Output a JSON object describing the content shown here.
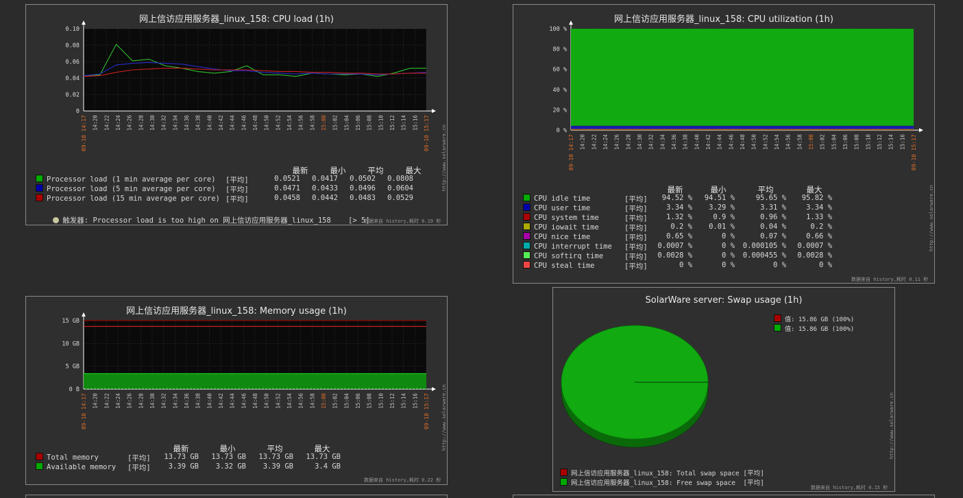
{
  "common": {
    "hdr": [
      "最新",
      "最小",
      "平均",
      "最大"
    ],
    "avg_tag": "[平均]",
    "xticks": [
      "14:20",
      "14:22",
      "14:24",
      "14:26",
      "14:28",
      "14:30",
      "14:32",
      "14:34",
      "14:36",
      "14:38",
      "14:40",
      "14:42",
      "14:44",
      "14:46",
      "14:48",
      "14:50",
      "14:52",
      "14:54",
      "14:56",
      "14:58",
      "15:00",
      "15:02",
      "15:04",
      "15:06",
      "15:08",
      "15:10",
      "15:12",
      "15:14",
      "15:16"
    ],
    "x_start": "09-10 14:17",
    "x_end": "09-10 15:17",
    "watermark": "http://www.solarware.cn",
    "colors": {
      "green": "#00c800",
      "blue": "#0000c8",
      "red": "#c80000",
      "orange": "#e0702a",
      "bg": "#2b2b2b",
      "plot": "#0a0a0a"
    }
  },
  "cpu_load": {
    "title": "网上信访应用服务器_linux_158: CPU load (1h)",
    "footer": "数据来自 history,耗时 0.19 秒",
    "legend": [
      {
        "color": "#00aa00",
        "name": "Processor load (1 min average per core)",
        "vals": [
          "0.0521",
          "0.0417",
          "0.0502",
          "0.0808"
        ]
      },
      {
        "color": "#0000aa",
        "name": "Processor load (5 min average per core)",
        "vals": [
          "0.0471",
          "0.0433",
          "0.0496",
          "0.0604"
        ]
      },
      {
        "color": "#aa0000",
        "name": "Processor load (15 min average per core)",
        "vals": [
          "0.0458",
          "0.0442",
          "0.0483",
          "0.0529"
        ]
      }
    ],
    "trigger_label": "触发器",
    "trigger_text": ": Processor load is too high on 网上信访应用服务器_linux_158    [> 5]"
  },
  "cpu_util": {
    "title": "网上信访应用服务器_linux_158: CPU utilization (1h)",
    "footer": "数据来自 history,耗时 0.11 秒",
    "legend": [
      {
        "color": "#00aa00",
        "name": "CPU idle time",
        "vals": [
          "94.52 %",
          "94.51 %",
          "95.65 %",
          "95.82 %"
        ]
      },
      {
        "color": "#0000aa",
        "name": "CPU user time",
        "vals": [
          "3.34 %",
          "3.29 %",
          "3.31 %",
          "3.34 %"
        ]
      },
      {
        "color": "#aa0000",
        "name": "CPU system time",
        "vals": [
          "1.32 %",
          "0.9 %",
          "0.96 %",
          "1.33 %"
        ]
      },
      {
        "color": "#aaaa00",
        "name": "CPU iowait time",
        "vals": [
          "0.2 %",
          "0.01 %",
          "0.04 %",
          "0.2 %"
        ]
      },
      {
        "color": "#aa00aa",
        "name": "CPU nice time",
        "vals": [
          "0.65 %",
          "0 %",
          "0.07 %",
          "0.66 %"
        ]
      },
      {
        "color": "#00aaaa",
        "name": "CPU interrupt time",
        "vals": [
          "0.0007 %",
          "0 %",
          "0.000105 %",
          "0.0007 %"
        ]
      },
      {
        "color": "#55ee55",
        "name": "CPU softirq time",
        "vals": [
          "0.0028 %",
          "0 %",
          "0.000455 %",
          "0.0028 %"
        ]
      },
      {
        "color": "#ee4444",
        "name": "CPU steal time",
        "vals": [
          "0 %",
          "0 %",
          "0 %",
          "0 %"
        ]
      }
    ]
  },
  "memory": {
    "title": "网上信访应用服务器_linux_158: Memory usage (1h)",
    "footer": "数据来自 history,耗时 0.22 秒",
    "legend": [
      {
        "color": "#aa0000",
        "name": "Total memory",
        "vals": [
          "13.73 GB",
          "13.73 GB",
          "13.73 GB",
          "13.73 GB"
        ]
      },
      {
        "color": "#00aa00",
        "name": "Available memory",
        "vals": [
          "3.39 GB",
          "3.32 GB",
          "3.39 GB",
          "3.4 GB"
        ]
      }
    ]
  },
  "swap": {
    "title": "SolarWare server: Swap usage (1h)",
    "footer": "数据来自 history,耗时 0.15 秒",
    "pie_legend": [
      {
        "color": "#aa0000",
        "text": "值: 15.86 GB (100%)"
      },
      {
        "color": "#00aa00",
        "text": "值: 15.86 GB (100%)"
      }
    ],
    "legend": [
      {
        "color": "#aa0000",
        "text": "网上信访应用服务器_linux_158: Total swap space [平均]"
      },
      {
        "color": "#00aa00",
        "text": "网上信访应用服务器_linux_158: Free swap space  [平均]"
      }
    ]
  },
  "chart_data": [
    {
      "type": "line",
      "title": "网上信访应用服务器_linux_158: CPU load (1h)",
      "x": [
        "14:17",
        "14:20",
        "14:22",
        "14:26",
        "14:30",
        "14:34",
        "14:38",
        "14:42",
        "14:46",
        "14:50",
        "14:54",
        "14:58",
        "15:02",
        "15:06",
        "15:10",
        "15:14",
        "15:17"
      ],
      "ylim": [
        0,
        0.1
      ],
      "yticks": [
        "0",
        "0.02",
        "0.04",
        "0.06",
        "0.08",
        "0.10"
      ],
      "series": [
        {
          "name": "Processor load (1 min average per core)",
          "color": "#2ec02e",
          "values": [
            0.043,
            0.044,
            0.081,
            0.061,
            0.063,
            0.055,
            0.052,
            0.048,
            0.046,
            0.048,
            0.055,
            0.044,
            0.044,
            0.042,
            0.046,
            0.045,
            0.044,
            0.045,
            0.042,
            0.046,
            0.052,
            0.052
          ]
        },
        {
          "name": "Processor load (5 min average per core)",
          "color": "#2a2acc",
          "values": [
            0.043,
            0.045,
            0.056,
            0.058,
            0.059,
            0.058,
            0.057,
            0.054,
            0.051,
            0.049,
            0.049,
            0.047,
            0.046,
            0.045,
            0.046,
            0.045,
            0.045,
            0.045,
            0.044,
            0.045,
            0.046,
            0.047
          ]
        },
        {
          "name": "Processor load (15 min average per core)",
          "color": "#cc2020",
          "values": [
            0.042,
            0.043,
            0.047,
            0.05,
            0.051,
            0.052,
            0.052,
            0.051,
            0.05,
            0.05,
            0.05,
            0.049,
            0.048,
            0.048,
            0.047,
            0.047,
            0.046,
            0.046,
            0.045,
            0.045,
            0.046,
            0.046
          ]
        }
      ]
    },
    {
      "type": "area",
      "title": "网上信访应用服务器_linux_158: CPU utilization (1h)",
      "ylim": [
        0,
        100
      ],
      "yticks": [
        "0 %",
        "20 %",
        "40 %",
        "60 %",
        "80 %",
        "100 %"
      ],
      "series": [
        {
          "name": "CPU idle time",
          "value": 95.65
        },
        {
          "name": "CPU user time",
          "value": 3.31
        },
        {
          "name": "CPU system time",
          "value": 0.96
        }
      ]
    },
    {
      "type": "area",
      "title": "网上信访应用服务器_linux_158: Memory usage (1h)",
      "ylim": [
        0,
        15
      ],
      "yticks": [
        "0 B",
        "5 GB",
        "10 GB",
        "15 GB"
      ],
      "series": [
        {
          "name": "Total memory",
          "value": 13.73
        },
        {
          "name": "Available memory",
          "value": 3.39
        }
      ]
    },
    {
      "type": "pie",
      "title": "SolarWare server: Swap usage (1h)",
      "slices": [
        {
          "name": "Total swap space",
          "value": 15.86
        },
        {
          "name": "Free swap space",
          "value": 15.86
        }
      ]
    }
  ]
}
